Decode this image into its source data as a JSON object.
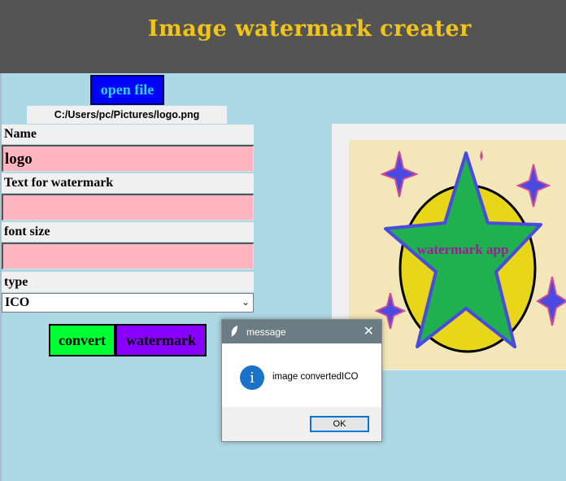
{
  "app": {
    "title": "Image watermark creater"
  },
  "toolbar": {
    "open_label": "open file",
    "file_path": "C:/Users/pc/Pictures/logo.png"
  },
  "form": {
    "name_label": "Name",
    "name_value": "logo",
    "text_label": "Text for watermark",
    "text_value": "",
    "size_label": "font size",
    "size_value": "",
    "type_label": "type",
    "type_value": "ICO"
  },
  "actions": {
    "convert_label": "convert",
    "watermark_label": "watermark"
  },
  "preview": {
    "logo_text": "watermark app"
  },
  "dialog": {
    "title": "message",
    "message": "image convertedICO",
    "ok_label": "OK",
    "close_glyph": "✕"
  },
  "colors": {
    "header": "#545454",
    "title": "#f2c418",
    "background": "#add8e6",
    "open_button": "#0000ff",
    "convert_button": "#00ff33",
    "watermark_button": "#8a00ff",
    "entry": "#ffb6c1"
  }
}
